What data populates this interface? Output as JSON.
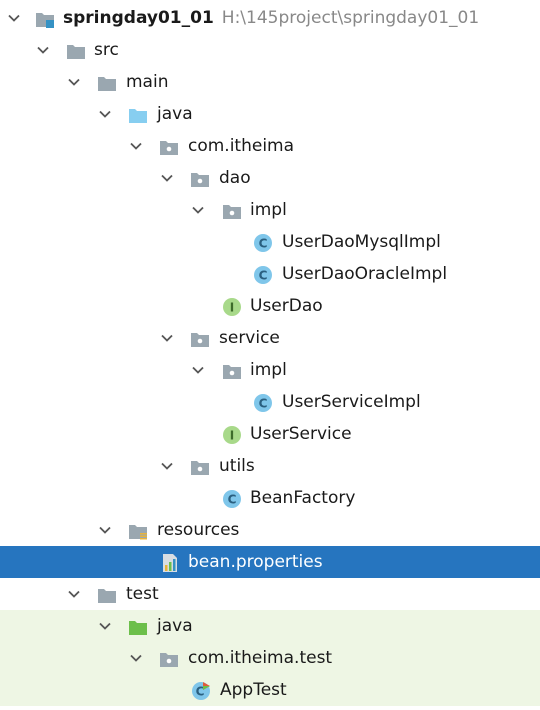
{
  "project": {
    "name": "springday01_01",
    "path": "H:\\145project\\springday01_01"
  },
  "tree": [
    {
      "id": "project",
      "label": "springday01_01",
      "type": "project",
      "expanded": true
    },
    {
      "id": "src",
      "label": "src",
      "type": "folder",
      "expanded": true
    },
    {
      "id": "main",
      "label": "main",
      "type": "folder",
      "expanded": true
    },
    {
      "id": "java-main",
      "label": "java",
      "type": "source-folder",
      "expanded": true
    },
    {
      "id": "com-itheima",
      "label": "com.itheima",
      "type": "package",
      "expanded": true
    },
    {
      "id": "dao",
      "label": "dao",
      "type": "package",
      "expanded": true
    },
    {
      "id": "dao-impl",
      "label": "impl",
      "type": "package",
      "expanded": true
    },
    {
      "id": "user-dao-mysql-impl",
      "label": "UserDaoMysqlImpl",
      "type": "class"
    },
    {
      "id": "user-dao-oracle-impl",
      "label": "UserDaoOracleImpl",
      "type": "class"
    },
    {
      "id": "user-dao",
      "label": "UserDao",
      "type": "interface"
    },
    {
      "id": "service",
      "label": "service",
      "type": "package",
      "expanded": true
    },
    {
      "id": "service-impl",
      "label": "impl",
      "type": "package",
      "expanded": true
    },
    {
      "id": "user-service-impl",
      "label": "UserServiceImpl",
      "type": "class"
    },
    {
      "id": "user-service",
      "label": "UserService",
      "type": "interface"
    },
    {
      "id": "utils",
      "label": "utils",
      "type": "package",
      "expanded": true
    },
    {
      "id": "bean-factory",
      "label": "BeanFactory",
      "type": "class"
    },
    {
      "id": "resources",
      "label": "resources",
      "type": "resources-folder",
      "expanded": true
    },
    {
      "id": "bean-properties",
      "label": "bean.properties",
      "type": "properties-file",
      "selected": true
    },
    {
      "id": "test",
      "label": "test",
      "type": "folder",
      "expanded": true
    },
    {
      "id": "java-test",
      "label": "java",
      "type": "test-source-folder",
      "expanded": true
    },
    {
      "id": "com-itheima-test",
      "label": "com.itheima.test",
      "type": "package",
      "expanded": true
    },
    {
      "id": "app-test",
      "label": "AppTest",
      "type": "test-class"
    }
  ],
  "icons": {
    "chevron": "chevron-down-icon",
    "project": "module-folder-icon",
    "folder": "folder-icon",
    "source-folder": "source-folder-icon",
    "test-source-folder": "test-source-folder-icon",
    "resources-folder": "resources-folder-icon",
    "package": "package-icon",
    "class": "class-icon",
    "interface": "interface-icon",
    "test-class": "test-class-icon",
    "properties-file": "properties-file-icon"
  },
  "colors": {
    "selection": "#2675bf",
    "test_background": "#eef6e4",
    "folder": "#9aa7b0",
    "source_folder": "#87cef0",
    "test_source_folder": "#6cbf4a",
    "class_circle": "#7fc6ea",
    "interface_circle": "#a8d98a",
    "path_text": "#888888"
  }
}
